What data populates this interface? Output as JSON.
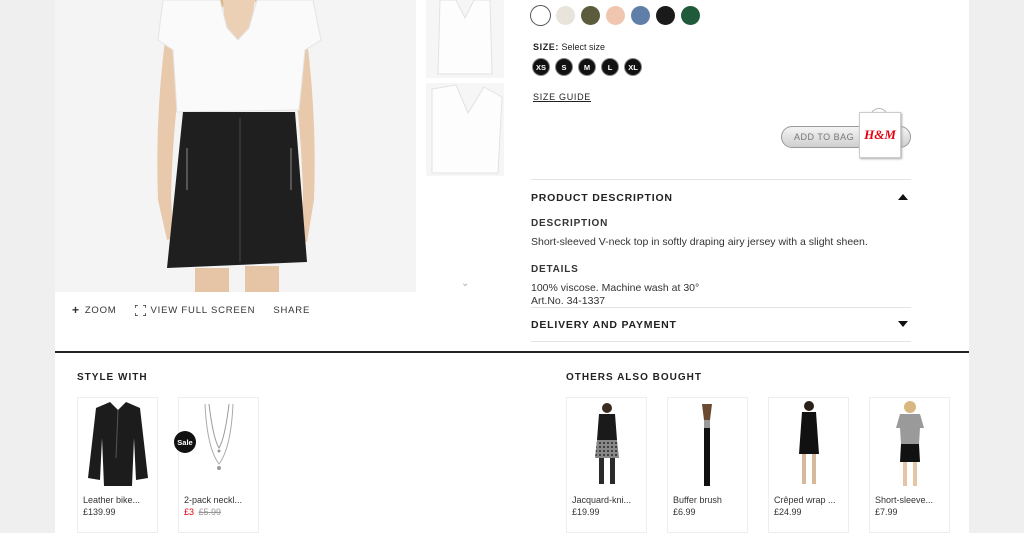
{
  "colors": {
    "swatches": [
      "#ffffff",
      "#e8e4dc",
      "#5c5c3c",
      "#f0c6b0",
      "#5f7ea8",
      "#1a1a1a",
      "#1f5a3a"
    ],
    "accent": "#e50010",
    "rule": "#222222"
  },
  "image_tools": {
    "zoom": "ZOOM",
    "fullscreen": "VIEW FULL SCREEN",
    "share": "SHARE"
  },
  "size": {
    "label": "SIZE:",
    "placeholder": "Select size",
    "options": [
      "XS",
      "S",
      "M",
      "L",
      "XL"
    ],
    "guide": "SIZE GUIDE"
  },
  "cart": {
    "add_to_bag": "ADD TO BAG",
    "logo": "H&M"
  },
  "product_description": {
    "heading": "PRODUCT DESCRIPTION",
    "description_label": "DESCRIPTION",
    "description": "Short-sleeved V-neck top in softly draping airy jersey with a slight sheen.",
    "details_label": "DETAILS",
    "details": "100% viscose. Machine wash at 30°",
    "art_no": "Art.No. 34-1337"
  },
  "delivery": {
    "heading": "DELIVERY AND PAYMENT"
  },
  "style_with": {
    "title": "STYLE WITH",
    "items": [
      {
        "name": "Leather bike...",
        "price": "£139.99"
      },
      {
        "name": "2-pack neckl...",
        "sale_price": "£3",
        "old_price": "£5.99",
        "badge": "Sale"
      }
    ]
  },
  "others_bought": {
    "title": "OTHERS ALSO BOUGHT",
    "items": [
      {
        "name": "Jacquard-kni...",
        "price": "£19.99"
      },
      {
        "name": "Buffer brush",
        "price": "£6.99"
      },
      {
        "name": "Crêped wrap ...",
        "price": "£24.99"
      },
      {
        "name": "Short-sleeve...",
        "price": "£7.99"
      }
    ]
  }
}
